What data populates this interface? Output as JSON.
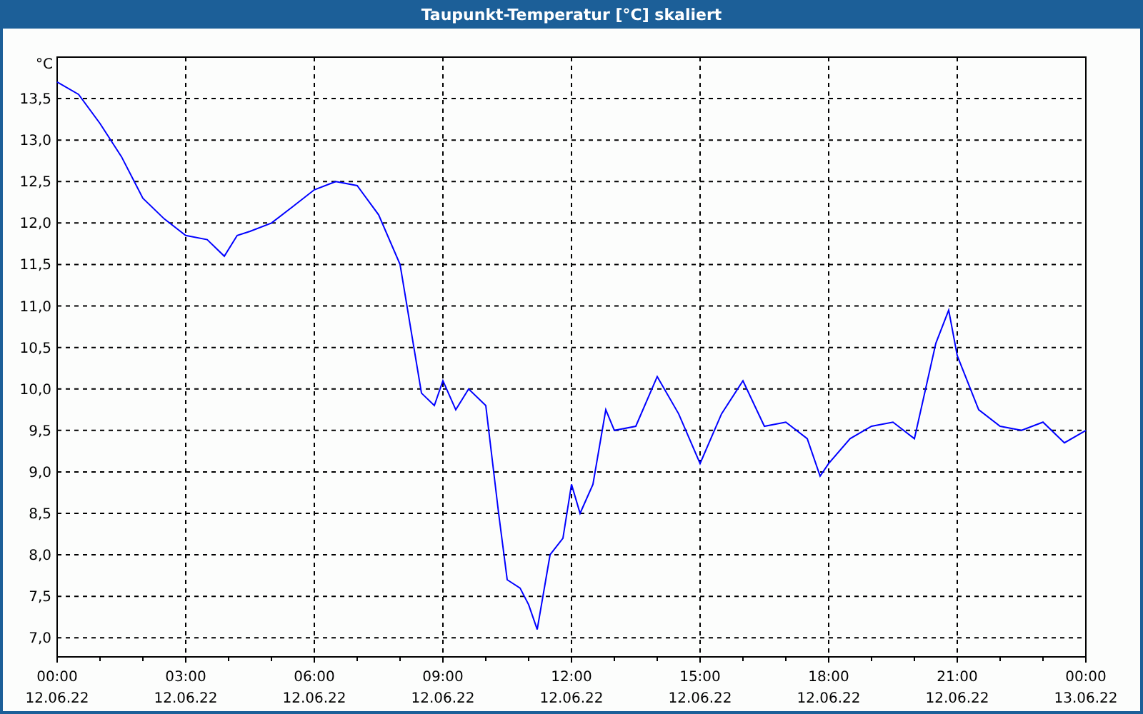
{
  "window": {
    "title": "Taupunkt-Temperatur [°C] skaliert"
  },
  "chart": {
    "x_dates": [
      "12.06.22",
      "12.06.22",
      "12.06.22",
      "12.06.22",
      "12.06.22",
      "12.06.22",
      "12.06.22",
      "12.06.22",
      "13.06.22"
    ],
    "chart_data": {
      "type": "line",
      "ylabel": "°C",
      "xlim": [
        0,
        24
      ],
      "ylim": [
        6.77,
        14.0
      ],
      "x": [
        0,
        0.5,
        1,
        1.5,
        2,
        2.5,
        3,
        3.5,
        3.9,
        4.2,
        4.5,
        5,
        5.5,
        6,
        6.5,
        7,
        7.5,
        8,
        8.5,
        8.8,
        9,
        9.3,
        9.6,
        10,
        10.3,
        10.5,
        10.8,
        11,
        11.2,
        11.5,
        11.8,
        12,
        12.2,
        12.5,
        12.8,
        13,
        13.5,
        14,
        14.5,
        15,
        15.5,
        16,
        16.5,
        17,
        17.5,
        17.8,
        18,
        18.5,
        19,
        19.5,
        20,
        20.5,
        20.8,
        21,
        21.5,
        22,
        22.5,
        23,
        23.5,
        24
      ],
      "grid": true,
      "series": [
        {
          "color": "#0000ff",
          "values": [
            13.7,
            13.55,
            13.2,
            12.8,
            12.3,
            12.05,
            11.85,
            11.8,
            11.6,
            11.85,
            11.9,
            12.0,
            12.2,
            12.4,
            12.5,
            12.45,
            12.1,
            11.5,
            9.95,
            9.8,
            10.1,
            9.75,
            10.0,
            9.8,
            8.5,
            7.7,
            7.6,
            7.4,
            7.1,
            8.0,
            8.2,
            8.85,
            8.5,
            8.85,
            9.75,
            9.5,
            9.55,
            10.15,
            9.7,
            9.1,
            9.7,
            10.1,
            9.55,
            9.6,
            9.4,
            8.95,
            9.1,
            9.4,
            9.55,
            9.6,
            9.4,
            10.55,
            10.95,
            10.4,
            9.75,
            9.55,
            9.5,
            9.6,
            9.35,
            9.5
          ]
        }
      ],
      "xticks": [
        {
          "value": 0,
          "label": "00:00"
        },
        {
          "value": 3,
          "label": "03:00"
        },
        {
          "value": 6,
          "label": "06:00"
        },
        {
          "value": 9,
          "label": "09:00"
        },
        {
          "value": 12,
          "label": "12:00"
        },
        {
          "value": 15,
          "label": "15:00"
        },
        {
          "value": 18,
          "label": "18:00"
        },
        {
          "value": 21,
          "label": "21:00"
        },
        {
          "value": 24,
          "label": "00:00"
        }
      ],
      "yticks": [
        {
          "value": 7,
          "label": "7,0"
        },
        {
          "value": 7.5,
          "label": "7,5"
        },
        {
          "value": 8,
          "label": "8,0"
        },
        {
          "value": 8.5,
          "label": "8,5"
        },
        {
          "value": 9,
          "label": "9,0"
        },
        {
          "value": 9.5,
          "label": "9,5"
        },
        {
          "value": 10,
          "label": "10,0"
        },
        {
          "value": 10.5,
          "label": "10,5"
        },
        {
          "value": 11,
          "label": "11,0"
        },
        {
          "value": 11.5,
          "label": "11,5"
        },
        {
          "value": 12,
          "label": "12,0"
        },
        {
          "value": 12.5,
          "label": "12,5"
        },
        {
          "value": 13,
          "label": "13,0"
        },
        {
          "value": 13.5,
          "label": "13,5"
        }
      ]
    }
  }
}
